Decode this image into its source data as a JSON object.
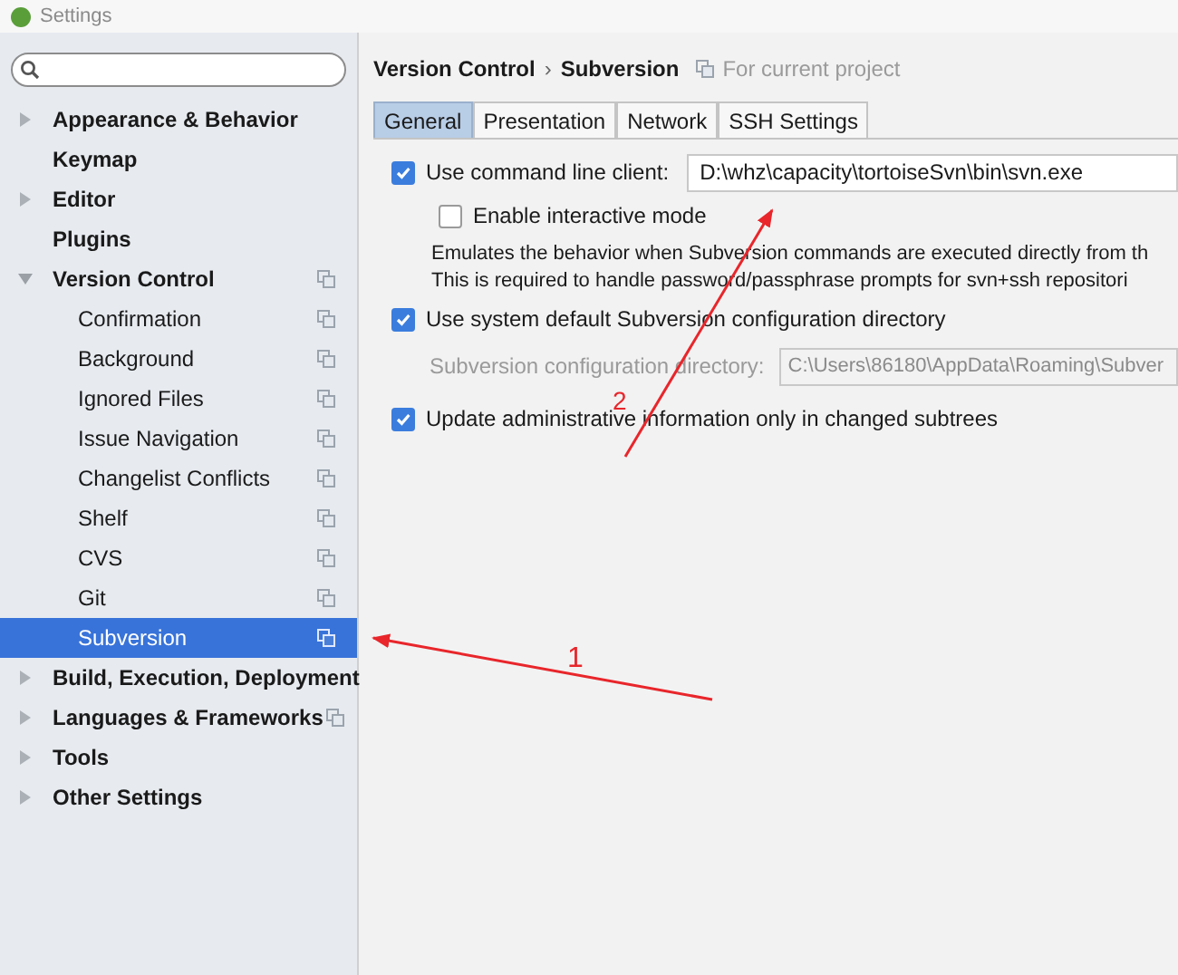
{
  "window": {
    "title": "Settings"
  },
  "sidebar": {
    "items": [
      {
        "label": "Appearance & Behavior",
        "kind": "group",
        "expanded": false,
        "project_icon": false,
        "selected": false
      },
      {
        "label": "Keymap",
        "kind": "leaf",
        "project_icon": false,
        "selected": false
      },
      {
        "label": "Editor",
        "kind": "group",
        "expanded": false,
        "project_icon": false,
        "selected": false
      },
      {
        "label": "Plugins",
        "kind": "leaf",
        "project_icon": false,
        "selected": false
      },
      {
        "label": "Version Control",
        "kind": "group",
        "expanded": true,
        "project_icon": true,
        "selected": false,
        "children": [
          {
            "label": "Confirmation",
            "project_icon": true,
            "selected": false
          },
          {
            "label": "Background",
            "project_icon": true,
            "selected": false
          },
          {
            "label": "Ignored Files",
            "project_icon": true,
            "selected": false
          },
          {
            "label": "Issue Navigation",
            "project_icon": true,
            "selected": false
          },
          {
            "label": "Changelist Conflicts",
            "project_icon": true,
            "selected": false
          },
          {
            "label": "Shelf",
            "project_icon": true,
            "selected": false
          },
          {
            "label": "CVS",
            "project_icon": true,
            "selected": false
          },
          {
            "label": "Git",
            "project_icon": true,
            "selected": false
          },
          {
            "label": "Subversion",
            "project_icon": true,
            "selected": true
          }
        ]
      },
      {
        "label": "Build, Execution, Deployment",
        "kind": "group",
        "expanded": false,
        "project_icon": false,
        "selected": false
      },
      {
        "label": "Languages & Frameworks",
        "kind": "group",
        "expanded": false,
        "project_icon": true,
        "selected": false
      },
      {
        "label": "Tools",
        "kind": "group",
        "expanded": false,
        "project_icon": false,
        "selected": false
      },
      {
        "label": "Other Settings",
        "kind": "group",
        "expanded": false,
        "project_icon": false,
        "selected": false
      }
    ]
  },
  "breadcrumb": {
    "parent": "Version Control",
    "separator": "›",
    "current": "Subversion",
    "scope": "For current project"
  },
  "tabs": [
    {
      "label": "General",
      "selected": true
    },
    {
      "label": "Presentation",
      "selected": false
    },
    {
      "label": "Network",
      "selected": false
    },
    {
      "label": "SSH Settings",
      "selected": false
    }
  ],
  "general": {
    "command_line": {
      "label": "Use command line client:",
      "checked": true,
      "value": "D:\\whz\\capacity\\tortoiseSvn\\bin\\svn.exe"
    },
    "interactive": {
      "label": "Enable interactive mode",
      "checked": false
    },
    "description": [
      "Emulates the behavior when Subversion commands are executed directly from th",
      "This is required to handle password/passphrase prompts for svn+ssh repositori"
    ],
    "system_config": {
      "label": "Use system default Subversion configuration directory",
      "checked": true
    },
    "config_dir": {
      "label": "Subversion configuration directory:",
      "value": "C:\\Users\\86180\\AppData\\Roaming\\Subver",
      "disabled": true
    },
    "update_admin": {
      "label": "Update administrative information only in changed subtrees",
      "checked": true
    }
  },
  "annotations": [
    {
      "label": "1"
    },
    {
      "label": "2"
    }
  ]
}
